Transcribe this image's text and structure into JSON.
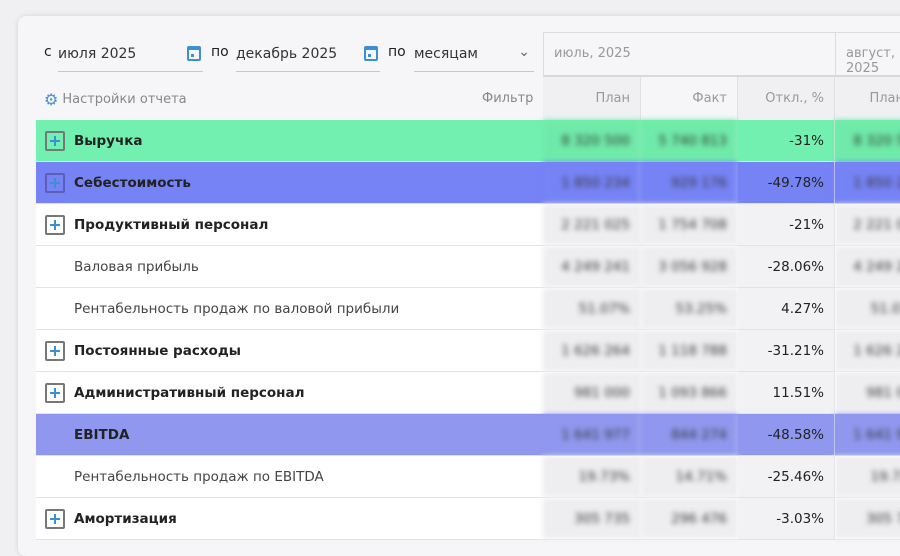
{
  "filters": {
    "from_label": "с",
    "from_value": "июля 2025",
    "to_label": "по",
    "to_value": "декабрь 2025",
    "group_label": "по",
    "group_value": "месяцам"
  },
  "toolbar": {
    "settings": "Настройки отчета",
    "filter": "Фильтр"
  },
  "months": [
    "июль, 2025",
    "август, 2025"
  ],
  "columns": {
    "plan": "План",
    "fact": "Факт",
    "dev": "Откл., %"
  },
  "colors": {
    "revenue": "#72f0b0",
    "cost": "#7683f5",
    "ebitda": "#8f98ee"
  },
  "rows": [
    {
      "label": "Выручка",
      "plan": "8 320 500",
      "fact": "5 740 813",
      "dev": "-31%"
    },
    {
      "label": "Себестоимость",
      "plan": "1 850 234",
      "fact": "929 176",
      "dev": "-49.78%"
    },
    {
      "label": "Продуктивный персонал",
      "plan": "2 221 025",
      "fact": "1 754 708",
      "dev": "-21%"
    },
    {
      "label": "Валовая прибыль",
      "plan": "4 249 241",
      "fact": "3 056 928",
      "dev": "-28.06%"
    },
    {
      "label": "Рентабельность продаж по валовой прибыли",
      "plan": "51.07%",
      "fact": "53.25%",
      "dev": "4.27%"
    },
    {
      "label": "Постоянные расходы",
      "plan": "1 626 264",
      "fact": "1 118 788",
      "dev": "-31.21%"
    },
    {
      "label": "Административный персонал",
      "plan": "981 000",
      "fact": "1 093 866",
      "dev": "11.51%"
    },
    {
      "label": "EBITDA",
      "plan": "1 641 977",
      "fact": "844 274",
      "dev": "-48.58%"
    },
    {
      "label": "Рентабельность продаж по EBITDA",
      "plan": "19.73%",
      "fact": "14.71%",
      "dev": "-25.46%"
    },
    {
      "label": "Амортизация",
      "plan": "305 735",
      "fact": "296 476",
      "dev": "-3.03%"
    }
  ]
}
